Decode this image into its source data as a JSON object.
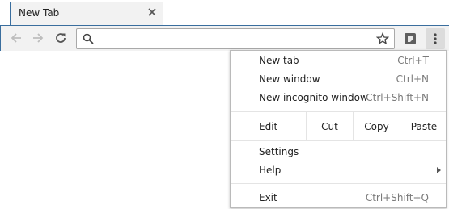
{
  "tab": {
    "title": "New Tab"
  },
  "omnibox": {
    "value": "",
    "placeholder": ""
  },
  "menu": {
    "items_top": [
      {
        "label": "New tab",
        "shortcut": "Ctrl+T"
      },
      {
        "label": "New window",
        "shortcut": "Ctrl+N"
      },
      {
        "label": "New incognito window",
        "shortcut": "Ctrl+Shift+N"
      }
    ],
    "edit": {
      "label": "Edit",
      "cut": "Cut",
      "copy": "Copy",
      "paste": "Paste"
    },
    "settings": "Settings",
    "help": "Help",
    "exit": {
      "label": "Exit",
      "shortcut": "Ctrl+Shift+Q"
    }
  },
  "icons": {
    "back": "arrow-left-icon",
    "forward": "arrow-right-icon",
    "reload": "reload-icon",
    "search": "search-icon",
    "star": "star-icon",
    "extension": "extension-icon",
    "menu": "kebab-menu-icon",
    "close": "close-icon"
  }
}
